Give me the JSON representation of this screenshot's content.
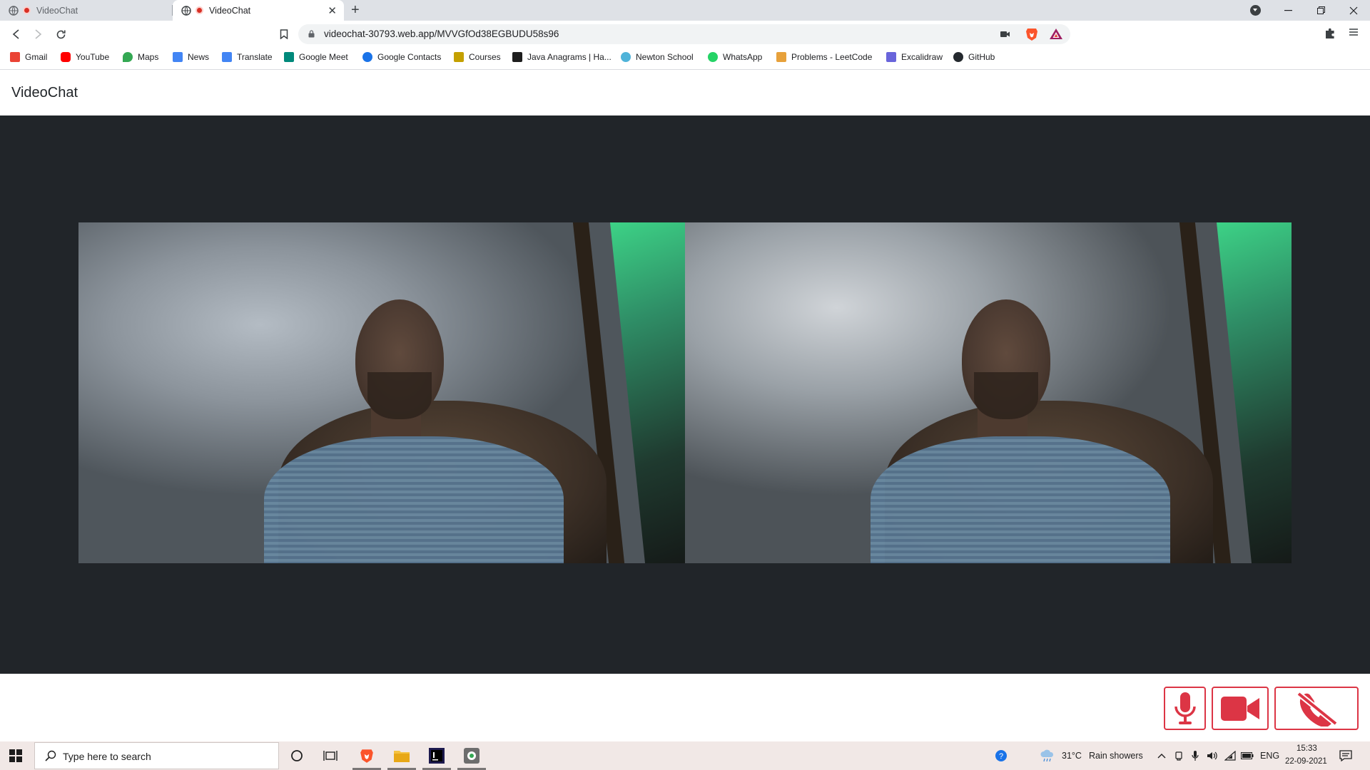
{
  "browser": {
    "tabs": [
      {
        "label": "VideoChat",
        "active": false
      },
      {
        "label": "VideoChat",
        "active": true
      }
    ],
    "url": "videochat-30793.web.app/MVVGfOd38EGBUDU58s96",
    "bookmarks": [
      {
        "label": "Gmail",
        "icon": "gmail-icon",
        "color": "#ea4335"
      },
      {
        "label": "YouTube",
        "icon": "youtube-icon",
        "color": "#ff0000"
      },
      {
        "label": "Maps",
        "icon": "maps-icon",
        "color": "#34a853"
      },
      {
        "label": "News",
        "icon": "news-icon",
        "color": "#4285f4"
      },
      {
        "label": "Translate",
        "icon": "translate-icon",
        "color": "#4285f4"
      },
      {
        "label": "Google Meet",
        "icon": "meet-icon",
        "color": "#00897b"
      },
      {
        "label": "Google Contacts",
        "icon": "contacts-icon",
        "color": "#1a73e8"
      },
      {
        "label": "Courses",
        "icon": "courses-icon",
        "color": "#c4a000"
      },
      {
        "label": "Java Anagrams | Ha...",
        "icon": "hackerrank-icon",
        "color": "#1e1e1e"
      },
      {
        "label": "Newton School",
        "icon": "newton-school-icon",
        "color": "#4fb3d9"
      },
      {
        "label": "WhatsApp",
        "icon": "whatsapp-icon",
        "color": "#25d366"
      },
      {
        "label": "Problems - LeetCode",
        "icon": "leetcode-icon",
        "color": "#e7a13b"
      },
      {
        "label": "Excalidraw",
        "icon": "excalidraw-icon",
        "color": "#6965db"
      },
      {
        "label": "GitHub",
        "icon": "github-icon",
        "color": "#24292e"
      }
    ]
  },
  "app": {
    "title": "VideoChat",
    "accent": "#dc3545",
    "stage_color": "#212529"
  },
  "taskbar": {
    "search_placeholder": "Type here to search",
    "weather": "31°C",
    "weather_desc": "Rain showers",
    "lang": "ENG",
    "time": "15:33",
    "date": "22-09-2021"
  }
}
